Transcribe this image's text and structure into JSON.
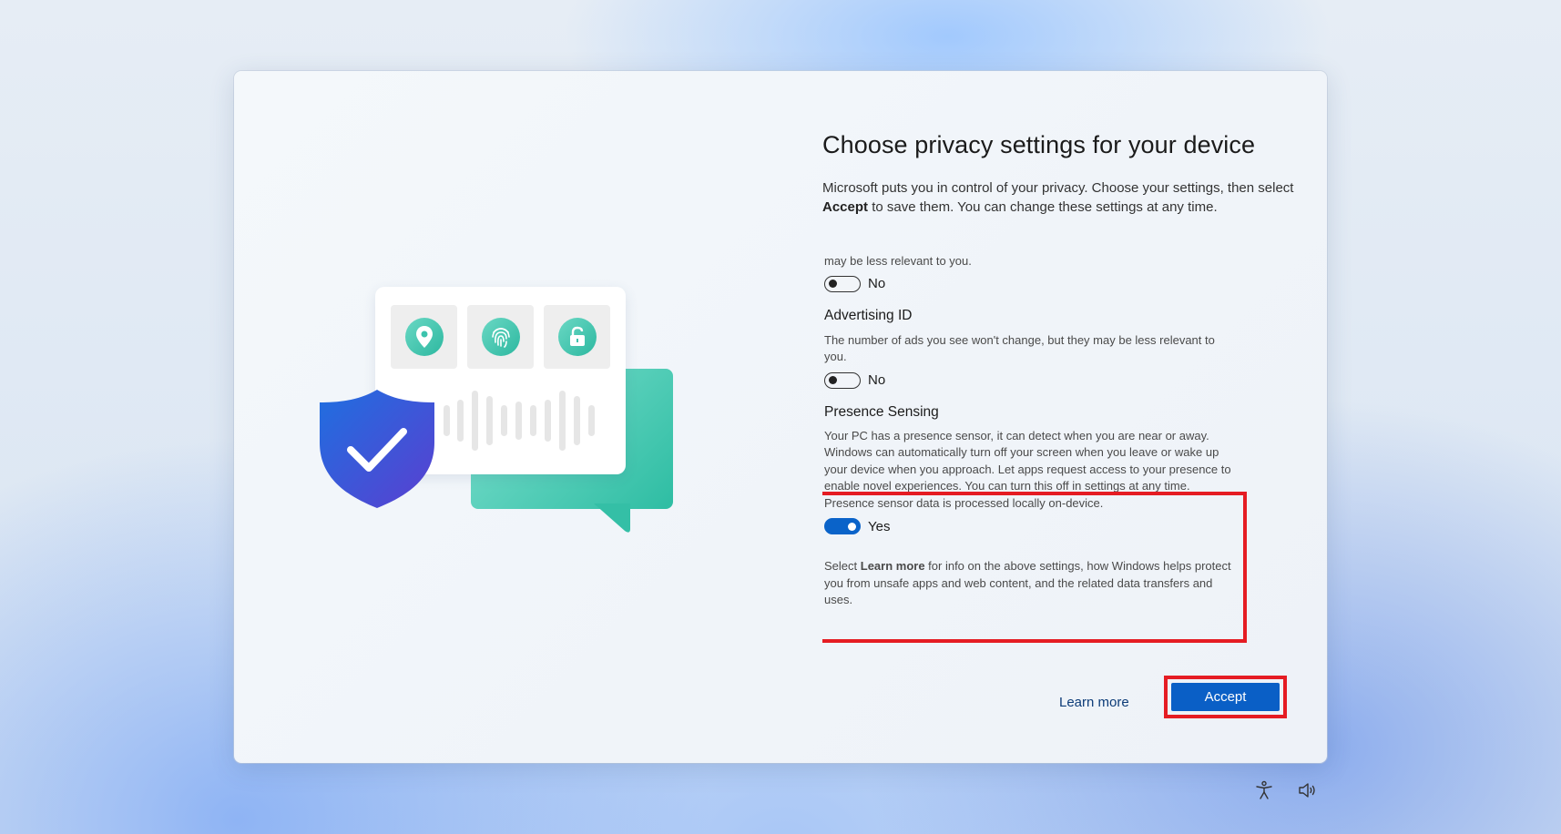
{
  "page": {
    "title": "Choose privacy settings for your device",
    "intro_part1": "Microsoft puts you in control of your privacy. Choose your settings, then select ",
    "intro_bold": "Accept",
    "intro_part2": " to save them. You can change these settings at any time."
  },
  "settings": {
    "partial_text": "may be less relevant to you.",
    "partial_toggle_label": "No",
    "partial_toggle_on": false,
    "advertising": {
      "heading": "Advertising ID",
      "description": "The number of ads you see won't change, but they may be less relevant to you.",
      "toggle_label": "No",
      "toggle_on": false
    },
    "presence": {
      "heading": "Presence Sensing",
      "description": "Your PC has a presence sensor, it can detect when you are near or away. Windows can automatically turn off your screen when you leave or wake up your device when you approach. Let apps request access to your presence to enable novel experiences. You can turn this off in settings at any time. Presence sensor data is processed locally on-device.",
      "toggle_label": "Yes",
      "toggle_on": true
    },
    "footer_part1": "Select ",
    "footer_bold": "Learn more",
    "footer_part2": " for info on the above settings, how Windows helps protect you from unsafe apps and web content, and the related data transfers and uses."
  },
  "actions": {
    "learn_more": "Learn more",
    "accept": "Accept"
  },
  "illustration_icons": [
    "location-pin-icon",
    "fingerprint-icon",
    "unlock-icon",
    "shield-check-icon",
    "chat-bubble-icon"
  ],
  "taskbar_icons": [
    "accessibility-icon",
    "volume-icon"
  ],
  "colors": {
    "accent": "#0a5fc6",
    "highlight": "#e51c23",
    "teal": "#2ebda3",
    "shield": "#3d4fd6"
  }
}
